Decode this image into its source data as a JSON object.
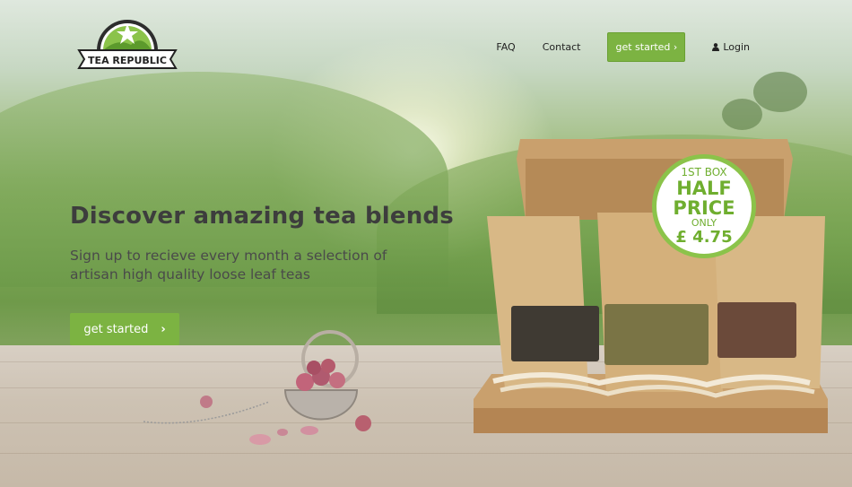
{
  "brand": {
    "name": "TEA REPUBLIC"
  },
  "nav": {
    "faq": "FAQ",
    "contact": "Contact",
    "cta": "get started ›",
    "login": "Login"
  },
  "hero": {
    "headline": "Discover amazing tea blends",
    "subheadline": "Sign up to recieve every month a selection of artisan high quality loose leaf teas",
    "cta": "get started"
  },
  "badge": {
    "line1": "1ST BOX",
    "line2": "HALF",
    "line3": "PRICE",
    "line4": "ONLY",
    "price": "£ 4.75"
  },
  "colors": {
    "accent": "#7cb342",
    "badge_border": "#8bc34a",
    "text_dark": "#3d3d3d"
  }
}
